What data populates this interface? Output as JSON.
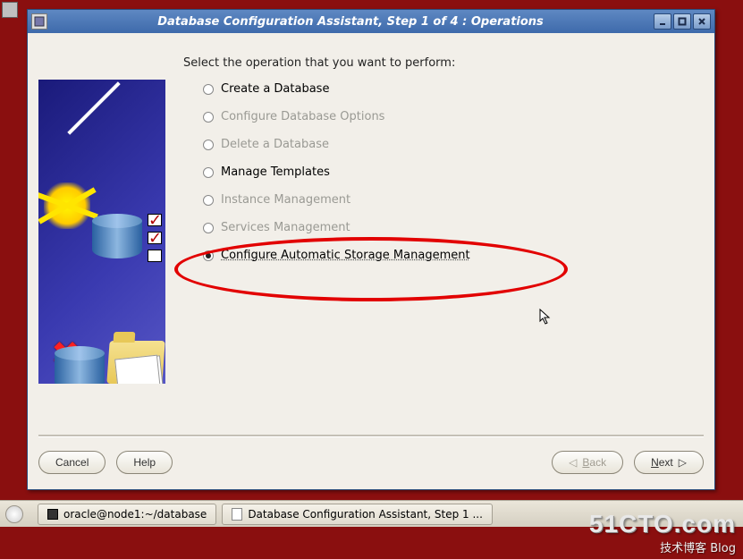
{
  "window": {
    "title": "Database Configuration Assistant, Step 1 of 4 : Operations"
  },
  "prompt": "Select the operation that you want to perform:",
  "options": [
    {
      "label": "Create a Database",
      "enabled": true,
      "selected": false
    },
    {
      "label": "Configure Database Options",
      "enabled": false,
      "selected": false
    },
    {
      "label": "Delete a Database",
      "enabled": false,
      "selected": false
    },
    {
      "label": "Manage Templates",
      "enabled": true,
      "selected": false
    },
    {
      "label": "Instance Management",
      "enabled": false,
      "selected": false
    },
    {
      "label": "Services Management",
      "enabled": false,
      "selected": false
    },
    {
      "label": "Configure Automatic Storage Management",
      "enabled": true,
      "selected": true
    }
  ],
  "buttons": {
    "cancel": "Cancel",
    "help": "Help",
    "back": "Back",
    "next": "Next"
  },
  "taskbar": {
    "terminal": "oracle@node1:~/database",
    "app": "Database Configuration Assistant, Step 1 ..."
  },
  "watermark": {
    "main": "51CTO.com",
    "sub": "技术博客   Blog"
  }
}
